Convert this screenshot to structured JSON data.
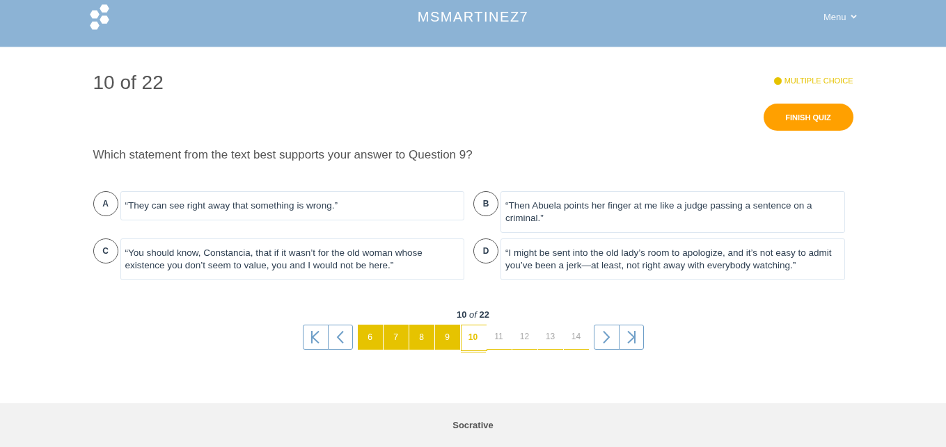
{
  "header": {
    "title": "MSMARTINEZ7",
    "menu": "Menu"
  },
  "quiz": {
    "progress": "10 of 22",
    "question_type": "MULTIPLE CHOICE",
    "finish_button": "FINISH QUIZ"
  },
  "question": {
    "text": "Which statement from the text best supports your answer to Question 9?",
    "answers": [
      {
        "letter": "A",
        "text": "“They can see right away that something is wrong.”"
      },
      {
        "letter": "B",
        "text": "“Then Abuela points her finger at me like a judge passing a sentence on a criminal.”"
      },
      {
        "letter": "C",
        "text": "“You should know, Constancia, that if it wasn’t for the old woman whose existence you don’t seem to value, you and I would not be here.”"
      },
      {
        "letter": "D",
        "text": "“I might be sent into the old lady’s room to apologize, and it’s not easy to admit you’ve been a jerk—at least, not right away with everybody watching.”"
      }
    ]
  },
  "pagination": {
    "counter": "**10** *of* **22**",
    "pages": [
      {
        "label": "6",
        "answered": true,
        "selected": false
      },
      {
        "label": "7",
        "answered": true,
        "selected": false
      },
      {
        "label": "8",
        "answered": true,
        "selected": false
      },
      {
        "label": "9",
        "answered": true,
        "selected": false
      },
      {
        "label": "10",
        "answered": false,
        "selected": true
      },
      {
        "label": "11",
        "answered": false,
        "selected": false
      },
      {
        "label": "12",
        "answered": false,
        "selected": false
      },
      {
        "label": "13",
        "answered": false,
        "selected": false
      },
      {
        "label": "14",
        "answered": false,
        "selected": false
      }
    ]
  },
  "footer": {
    "text": "Socrative"
  }
}
